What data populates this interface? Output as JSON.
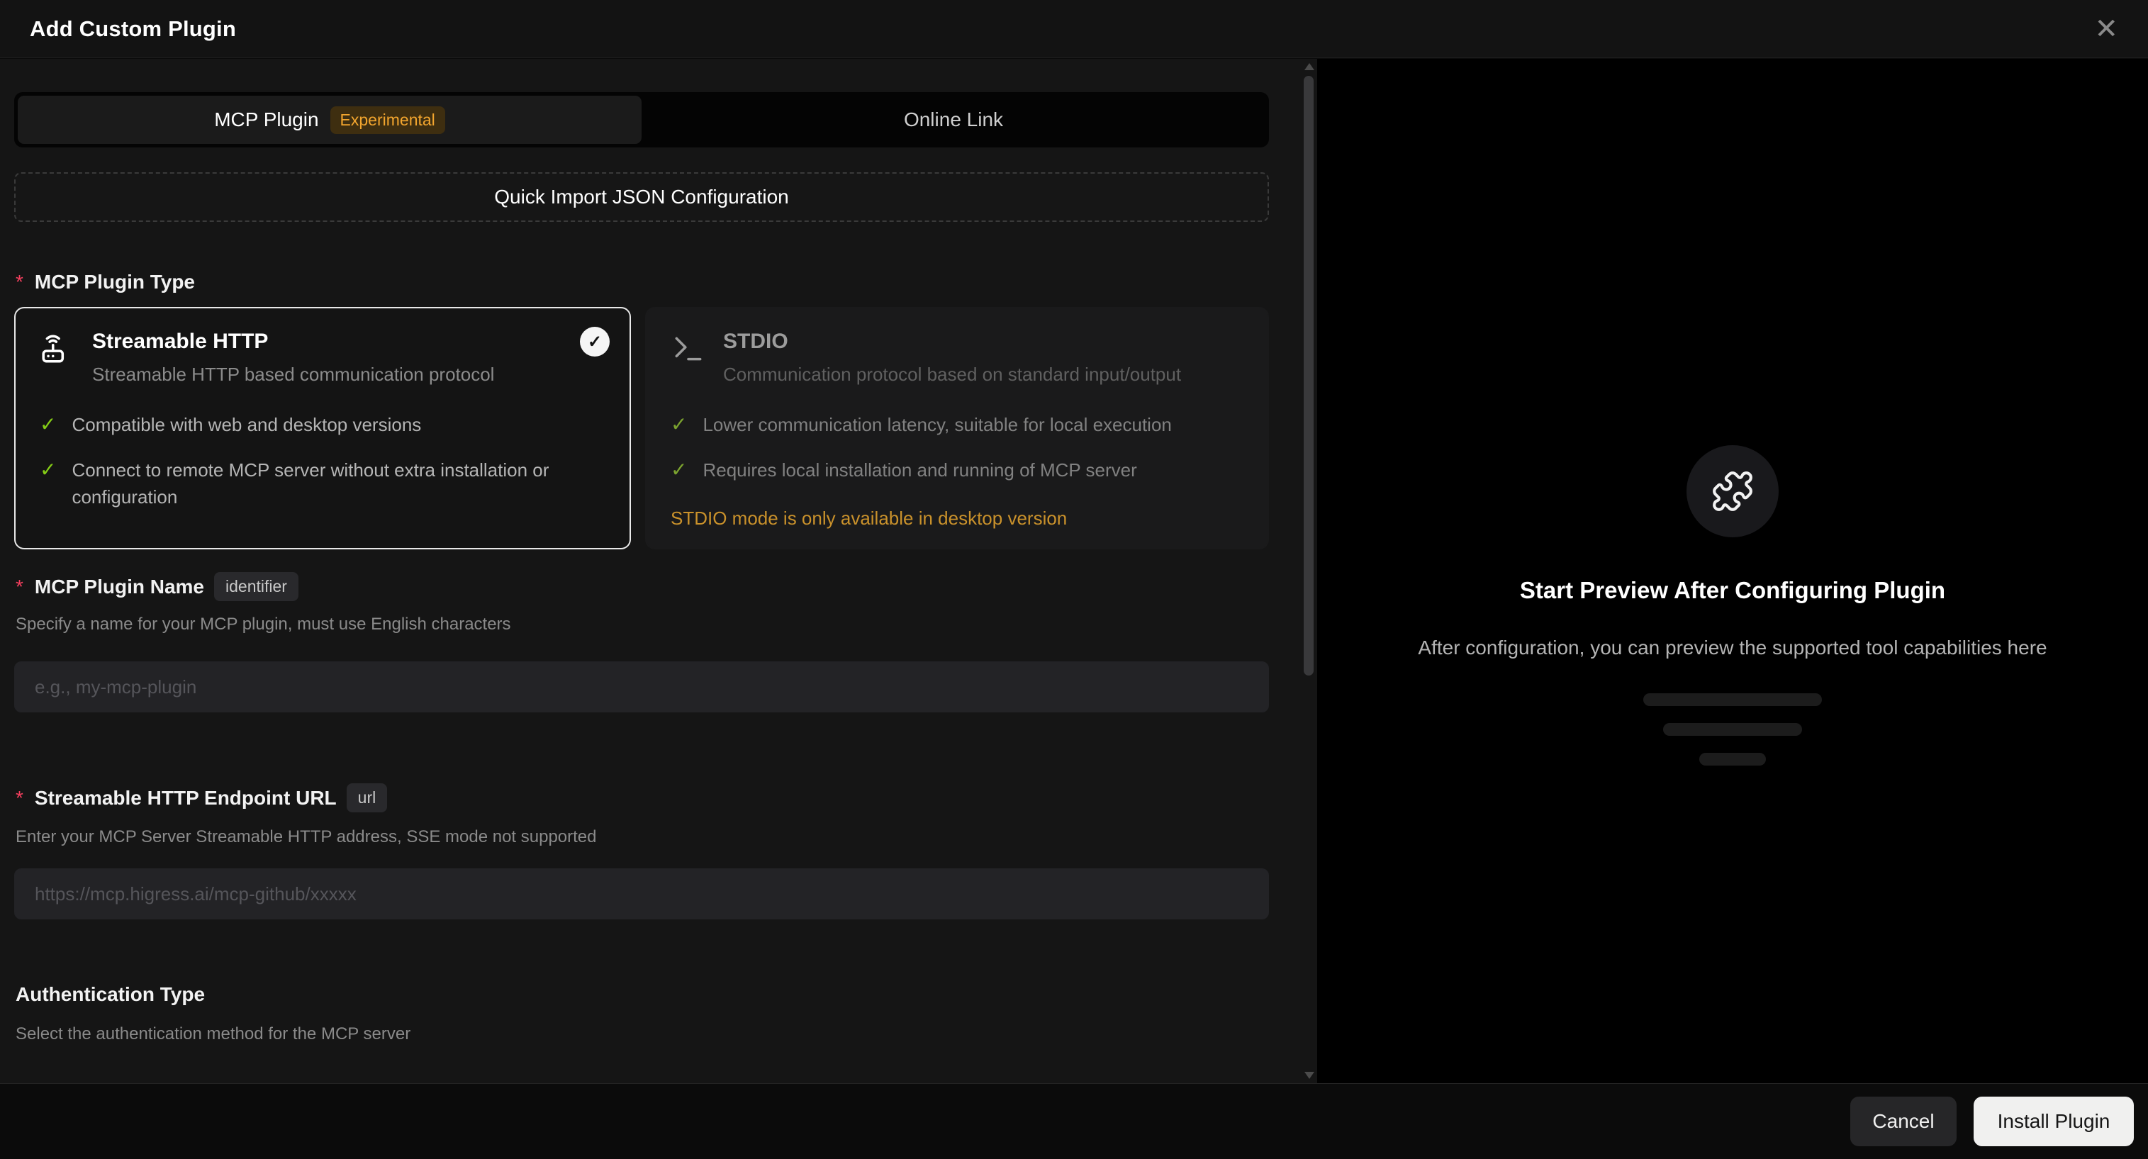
{
  "dialog": {
    "title": "Add Custom Plugin"
  },
  "icons": {
    "close": "✕",
    "check": "✓"
  },
  "tabs": {
    "mcp": {
      "label": "MCP Plugin",
      "badge": "Experimental"
    },
    "online": {
      "label": "Online Link"
    }
  },
  "quick_import": {
    "label": "Quick Import JSON Configuration"
  },
  "plugin_type": {
    "required_mark": "*",
    "label": "MCP Plugin Type",
    "options": [
      {
        "title": "Streamable HTTP",
        "subtitle": "Streamable HTTP based communication protocol",
        "selected": true,
        "features": [
          "Compatible with web and desktop versions",
          "Connect to remote MCP server without extra installation or configuration"
        ]
      },
      {
        "title": "STDIO",
        "subtitle": "Communication protocol based on standard input/output",
        "selected": false,
        "features": [
          "Lower communication latency, suitable for local execution",
          "Requires local installation and running of MCP server"
        ],
        "note": "STDIO mode is only available in desktop version"
      }
    ]
  },
  "name_field": {
    "required_mark": "*",
    "label": "MCP Plugin Name",
    "badge": "identifier",
    "help": "Specify a name for your MCP plugin, must use English characters",
    "placeholder": "e.g., my-mcp-plugin",
    "value": ""
  },
  "url_field": {
    "required_mark": "*",
    "label": "Streamable HTTP Endpoint URL",
    "badge": "url",
    "help": "Enter your MCP Server Streamable HTTP address, SSE mode not supported",
    "placeholder": "https://mcp.higress.ai/mcp-github/xxxxx",
    "value": ""
  },
  "auth_field": {
    "label": "Authentication Type",
    "help": "Select the authentication method for the MCP server"
  },
  "preview": {
    "heading": "Start Preview After Configuring Plugin",
    "subtext": "After configuration, you can preview the supported tool capabilities here"
  },
  "footer": {
    "cancel_label": "Cancel",
    "install_label": "Install Plugin"
  },
  "colors": {
    "experimental_badge_bg": "#3e2e10",
    "experimental_badge_text": "#f2a52e",
    "success_check": "#84cc16",
    "warning_text": "#c9912b",
    "required_mark": "#f43f5e",
    "panel_bg": "#151515",
    "preview_bg": "#000000",
    "primary_button_bg": "#f0f0ef"
  }
}
